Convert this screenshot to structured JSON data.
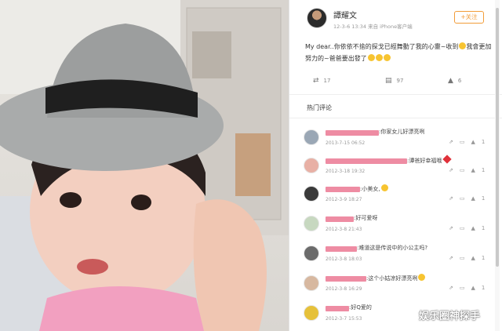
{
  "post": {
    "username": "譚耀文",
    "meta": "12-3-6 13:34  来自 iPhone客户端",
    "follow_label": "+关注",
    "text_a": "My dear..你依依不捨的探戈已經舞動了我的心靈~收到",
    "text_b": "我會更加努力的~爸爸要出發了",
    "repost_count": "17",
    "comment_count": "97",
    "like_count": "6"
  },
  "comments_section": {
    "title": "热门评论",
    "items": [
      {
        "text": ":你家女儿好漂亮咧",
        "date": "2013-7-15 06:52",
        "like": "1",
        "avatar_color": "#9aa7b5"
      },
      {
        "text": ":谭爸好幸福哦",
        "date": "2012-3-18 19:32",
        "like": "1",
        "avatar_color": "#e8b0a5"
      },
      {
        "text": ":小美女,",
        "date": "2012-3-9 18:27",
        "like": "1",
        "avatar_color": "#3a3a3a"
      },
      {
        "text": ":好可爱呀",
        "date": "2012-3-8 21:43",
        "like": "1",
        "avatar_color": "#c7d8c0"
      },
      {
        "text": ":难道这是传说中的小公主吗?",
        "date": "2012-3-8 18:03",
        "like": "1",
        "avatar_color": "#6b6b6b"
      },
      {
        "text": ":这个小姑凉好漂亮咧",
        "date": "2012-3-8 16:29",
        "like": "1",
        "avatar_color": "#d7b8a0"
      },
      {
        "text": ":好Q爱的",
        "date": "2012-3-7 15:53",
        "like": "",
        "avatar_color": "#e6c13a"
      }
    ]
  },
  "watermark": "娱乐圈神探手"
}
